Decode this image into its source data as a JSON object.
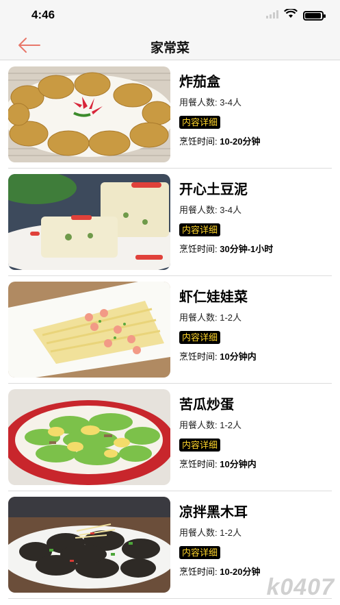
{
  "status_bar": {
    "time": "4:46"
  },
  "nav": {
    "title": "家常菜",
    "back_icon": "back-arrow-icon",
    "accent": "#e8776a"
  },
  "recipes": [
    {
      "name": "炸茄盒",
      "servings_label": "用餐人数:",
      "servings": "3-4人",
      "detail_label": "内容详细",
      "time_label": "烹饪时间:",
      "time": "10-20分钟"
    },
    {
      "name": "开心土豆泥",
      "servings_label": "用餐人数:",
      "servings": "3-4人",
      "detail_label": "内容详细",
      "time_label": "烹饪时间:",
      "time": "30分钟-1小时"
    },
    {
      "name": "虾仁娃娃菜",
      "servings_label": "用餐人数:",
      "servings": "1-2人",
      "detail_label": "内容详细",
      "time_label": "烹饪时间:",
      "time": "10分钟内"
    },
    {
      "name": "苦瓜炒蛋",
      "servings_label": "用餐人数:",
      "servings": "1-2人",
      "detail_label": "内容详细",
      "time_label": "烹饪时间:",
      "time": "10分钟内"
    },
    {
      "name": "凉拌黑木耳",
      "servings_label": "用餐人数:",
      "servings": "1-2人",
      "detail_label": "内容详细",
      "time_label": "烹饪时间:",
      "time": "10-20分钟"
    }
  ],
  "colors": {
    "tag_bg": "#000000",
    "tag_text": "#ffd52a"
  },
  "watermark": "k0407"
}
